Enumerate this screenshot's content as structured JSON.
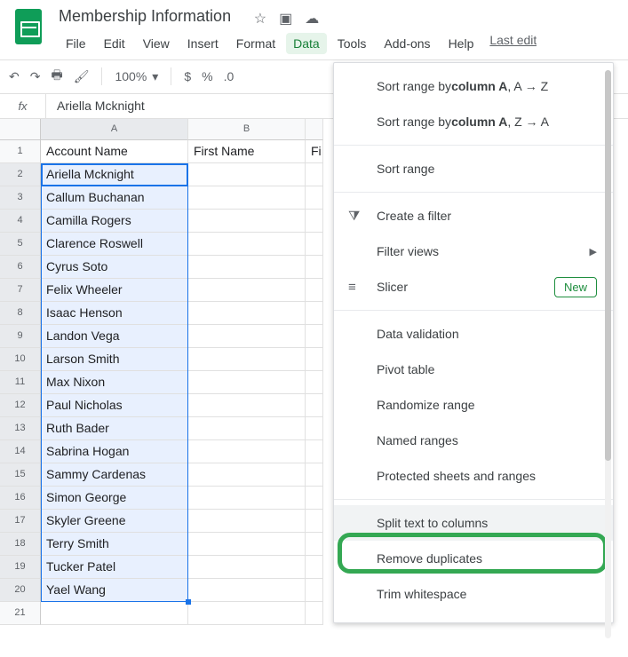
{
  "doc": {
    "title": "Membership Information"
  },
  "menubar": {
    "items": [
      "File",
      "Edit",
      "View",
      "Insert",
      "Format",
      "Data",
      "Tools",
      "Add-ons",
      "Help"
    ],
    "active_index": 5,
    "last_edit": "Last edit"
  },
  "toolbar": {
    "zoom": "100%",
    "currency": "$",
    "percent": "%",
    "decimal": ".0"
  },
  "formula_bar": {
    "fx": "fx",
    "value": "Ariella Mcknight"
  },
  "columns": {
    "A": "A",
    "B": "B",
    "C": ""
  },
  "headers": {
    "a": "Account Name",
    "b": "First Name",
    "c": "Fi"
  },
  "data_rows": [
    "Ariella Mcknight",
    "Callum Buchanan",
    "Camilla Rogers",
    "Clarence Roswell",
    "Cyrus Soto",
    "Felix Wheeler",
    "Isaac Henson",
    "Landon Vega",
    "Larson Smith",
    "Max Nixon",
    "Paul Nicholas",
    "Ruth Bader",
    "Sabrina Hogan",
    "Sammy Cardenas",
    "Simon George",
    "Skyler Greene",
    "Terry Smith",
    "Tucker Patel",
    "Yael Wang"
  ],
  "menu": {
    "sort_asc_pre": "Sort range by ",
    "sort_asc_col": "column A",
    "sort_asc_suf": ", A → Z",
    "sort_desc_pre": "Sort range by ",
    "sort_desc_col": "column A",
    "sort_desc_suf": ", Z → A",
    "sort_range": "Sort range",
    "create_filter": "Create a filter",
    "filter_views": "Filter views",
    "slicer": "Slicer",
    "slicer_badge": "New",
    "data_validation": "Data validation",
    "pivot": "Pivot table",
    "randomize": "Randomize range",
    "named_ranges": "Named ranges",
    "protected": "Protected sheets and ranges",
    "split": "Split text to columns",
    "remove_dup": "Remove duplicates",
    "trim": "Trim whitespace"
  }
}
